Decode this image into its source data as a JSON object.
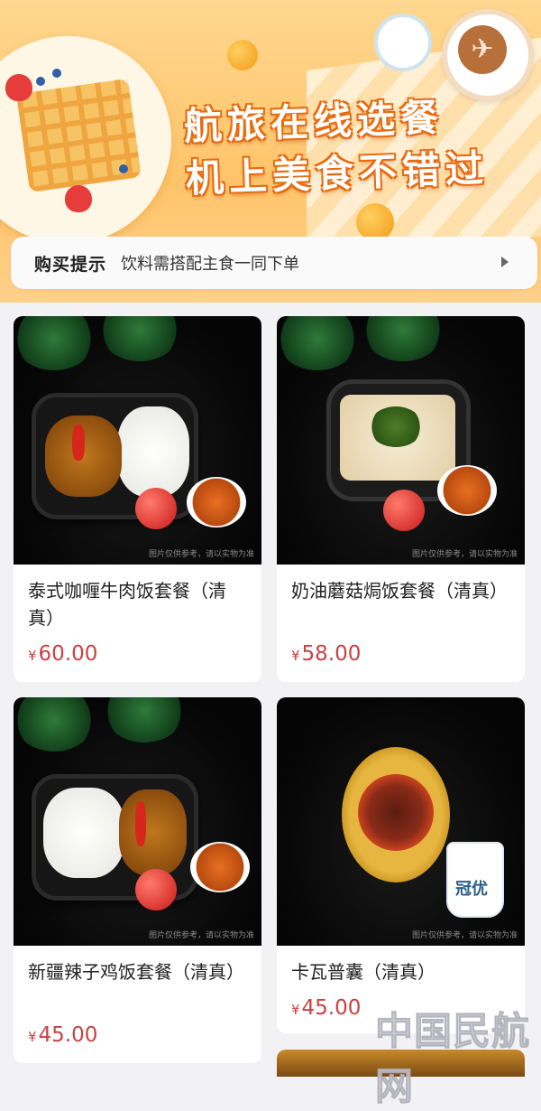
{
  "banner": {
    "line1": "航旅在线选餐",
    "line2": "机上美食不错过"
  },
  "tip": {
    "title": "购买提示",
    "text": "饮料需搭配主食一同下单"
  },
  "currency": "¥",
  "image_caption": "图片仅供参考，请以实物为准",
  "products": [
    {
      "name": "泰式咖喱牛肉饭套餐（清真）",
      "price": "60.00"
    },
    {
      "name": "奶油蘑菇焗饭套餐（清真）",
      "price": "58.00"
    },
    {
      "name": "新疆辣子鸡饭套餐（清真）",
      "price": "45.00"
    },
    {
      "name": "卡瓦普囊（清真）",
      "price": "45.00"
    }
  ],
  "yogurt_label": "冠优",
  "watermark": "中国民航网"
}
